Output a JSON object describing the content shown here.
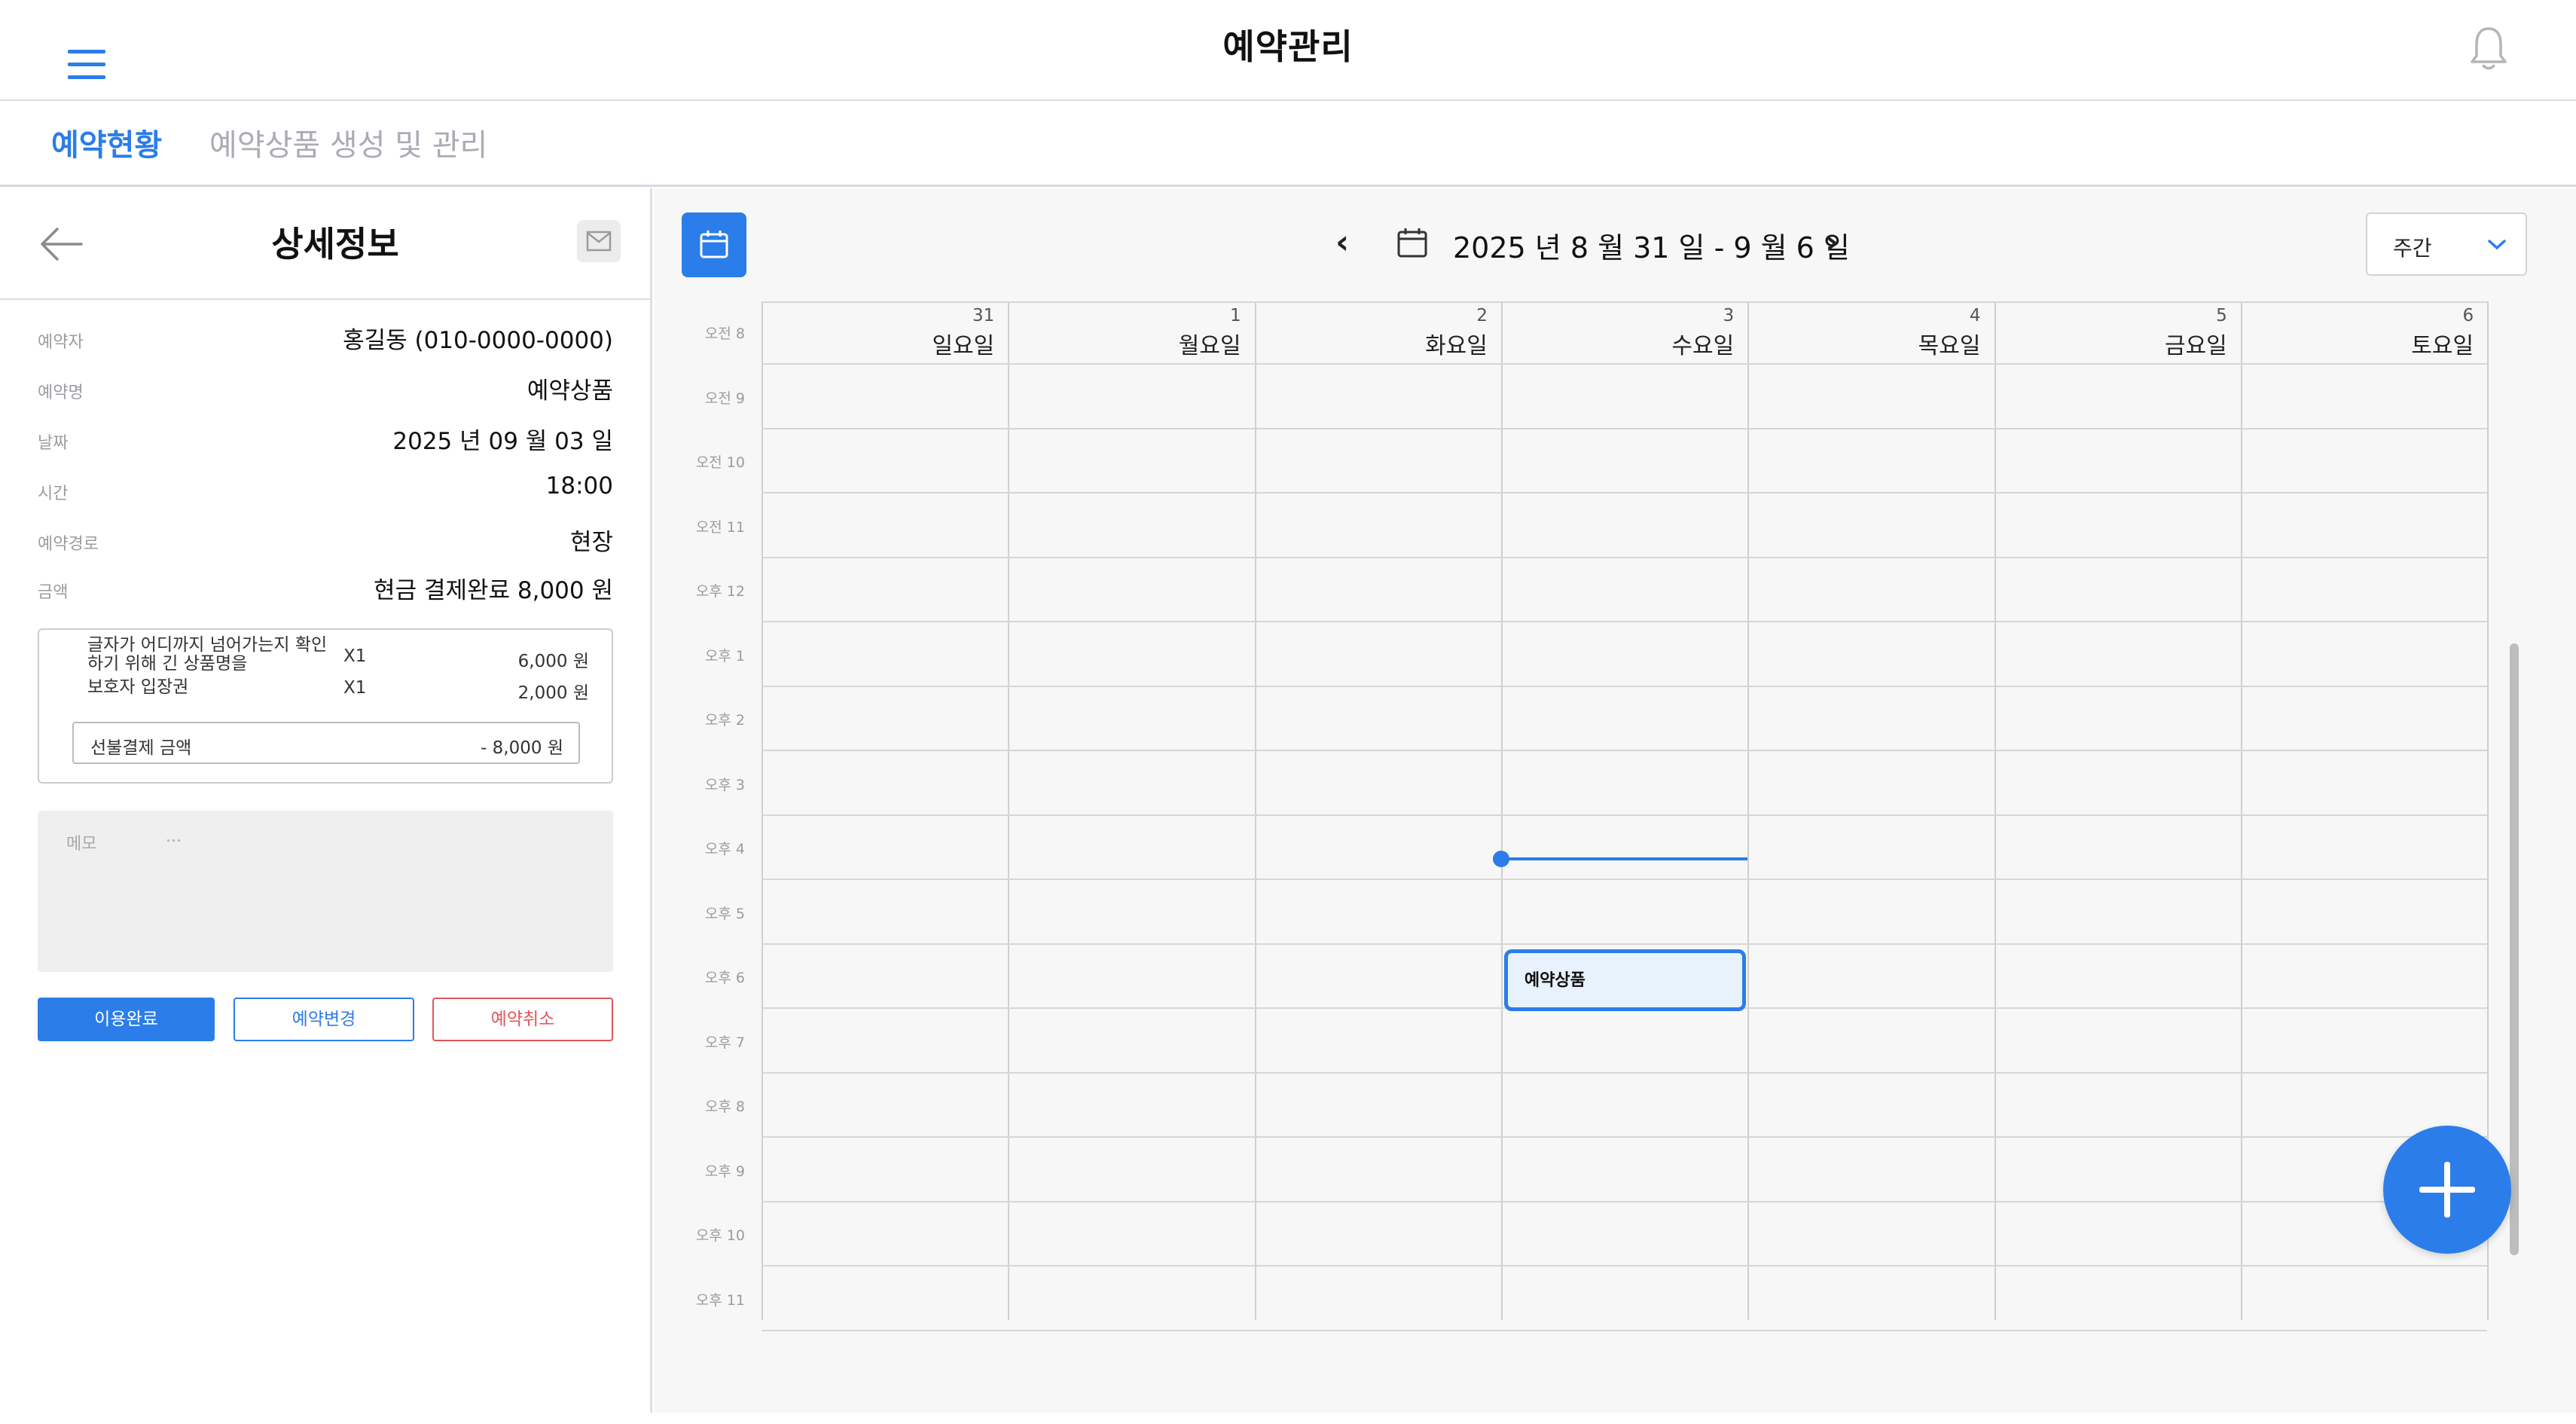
{
  "app": {
    "title": "예약관리"
  },
  "tabs": [
    {
      "label": "예약현황",
      "active": true
    },
    {
      "label": "예약상품 생성 및 관리",
      "active": false
    }
  ],
  "detail": {
    "title": "상세정보",
    "rows": [
      {
        "label": "예약자",
        "value": "홍길동 (010-0000-0000)"
      },
      {
        "label": "예약명",
        "value": "예약상품"
      },
      {
        "label": "날짜",
        "value": "2025 년 09 월 03 일"
      },
      {
        "label": "시간",
        "value": "18:00"
      },
      {
        "label": "예약경로",
        "value": "현장"
      },
      {
        "label": "금액",
        "value": "현금 결제완료  8,000 원"
      }
    ],
    "items": [
      {
        "name": "글자가 어디까지 넘어가는지 확인하기 위해 긴 상품명을",
        "qty": "X1",
        "price": "6,000 원"
      },
      {
        "name": "보호자 입장권",
        "qty": "X1",
        "price": "2,000 원"
      }
    ],
    "prepay": {
      "label": "선불결제 금액",
      "value": "- 8,000 원"
    },
    "memo": {
      "placeholder": "메모",
      "hint": "..."
    },
    "buttons": {
      "done": "이용완료",
      "change": "예약변경",
      "cancel": "예약취소"
    }
  },
  "calendar": {
    "range": "2025 년  8 월  31 일 - 9 월  6 일",
    "prev": "‹",
    "next": "›",
    "view": "주간",
    "days": [
      {
        "num": "31",
        "name": "일요일"
      },
      {
        "num": "1",
        "name": "월요일"
      },
      {
        "num": "2",
        "name": "화요일"
      },
      {
        "num": "3",
        "name": "수요일"
      },
      {
        "num": "4",
        "name": "목요일"
      },
      {
        "num": "5",
        "name": "금요일"
      },
      {
        "num": "6",
        "name": "토요일"
      }
    ],
    "times": [
      "오전 8",
      "오전 9",
      "오전 10",
      "오전 11",
      "오후 12",
      "오후 1",
      "오후 2",
      "오후 3",
      "오후 4",
      "오후 5",
      "오후 6",
      "오후 7",
      "오후 8",
      "오후 9",
      "오후 10",
      "오후 11"
    ],
    "event": {
      "title": "예약상품",
      "day": "수요일",
      "time": "오후 6"
    },
    "accent": "#2b7de9"
  },
  "icons": [
    "menu-icon",
    "bell-icon",
    "back-arrow-icon",
    "mail-icon",
    "calendar-icon",
    "chevron-down-icon",
    "plus-icon"
  ]
}
